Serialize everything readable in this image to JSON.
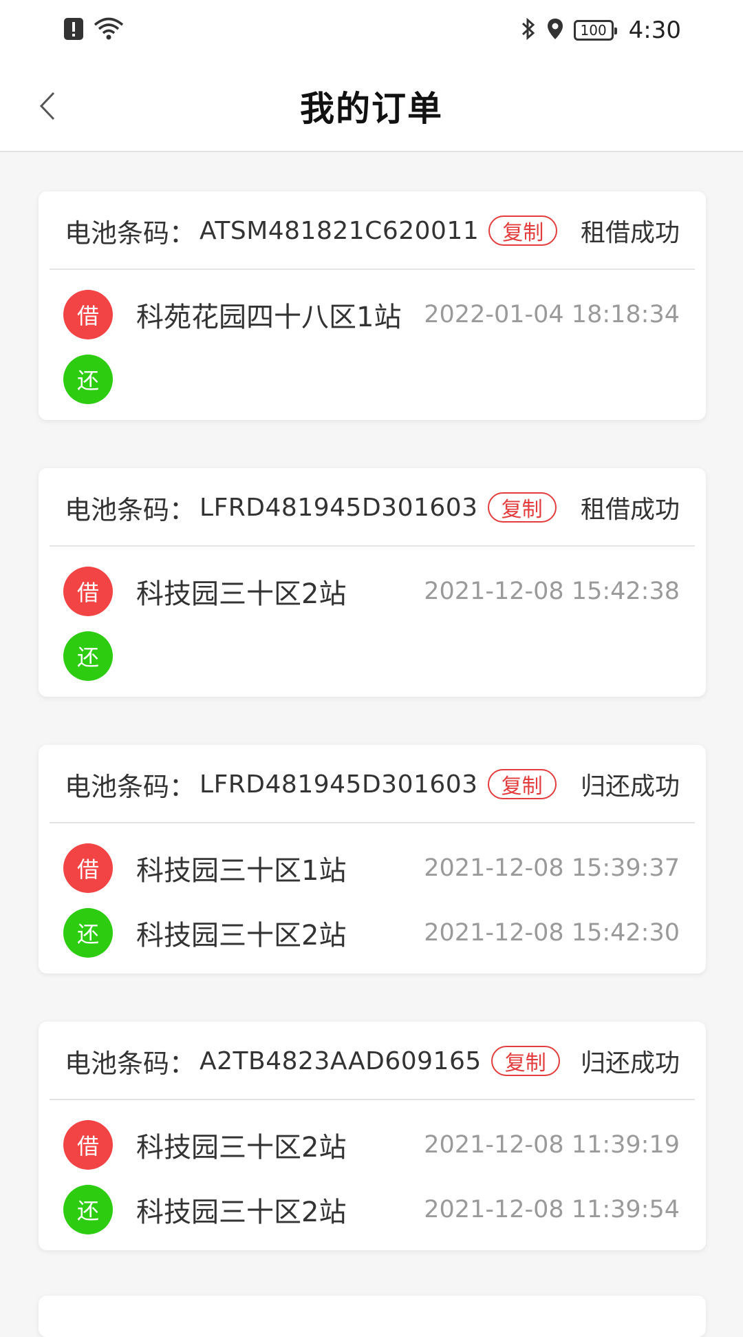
{
  "statusbar": {
    "time": "4:30",
    "battery": "100",
    "icons_left": [
      "alert-icon",
      "wifi-icon"
    ],
    "icons_right": [
      "bluetooth-icon",
      "location-icon",
      "battery-icon"
    ]
  },
  "header": {
    "title": "我的订单",
    "back_icon": "chevron-left-icon"
  },
  "labels": {
    "barcode_label": "电池条码：",
    "copy": "复制",
    "borrow_badge": "借",
    "return_badge": "还"
  },
  "orders": [
    {
      "barcode": "ATSM481821C620011",
      "status": "租借成功",
      "borrow": {
        "station": "科苑花园四十八区1站",
        "time": "2022-01-04 18:18:34"
      },
      "return": {
        "station": "",
        "time": ""
      }
    },
    {
      "barcode": "LFRD481945D301603",
      "status": "租借成功",
      "borrow": {
        "station": "科技园三十区2站",
        "time": "2021-12-08 15:42:38"
      },
      "return": {
        "station": "",
        "time": ""
      }
    },
    {
      "barcode": "LFRD481945D301603",
      "status": "归还成功",
      "borrow": {
        "station": "科技园三十区1站",
        "time": "2021-12-08 15:39:37"
      },
      "return": {
        "station": "科技园三十区2站",
        "time": "2021-12-08 15:42:30"
      }
    },
    {
      "barcode": "A2TB4823AAD609165",
      "status": "归还成功",
      "borrow": {
        "station": "科技园三十区2站",
        "time": "2021-12-08 11:39:19"
      },
      "return": {
        "station": "科技园三十区2站",
        "time": "2021-12-08 11:39:54"
      }
    }
  ],
  "colors": {
    "borrow": "#f24444",
    "return": "#2dcc10",
    "accent": "#e33c3c"
  }
}
